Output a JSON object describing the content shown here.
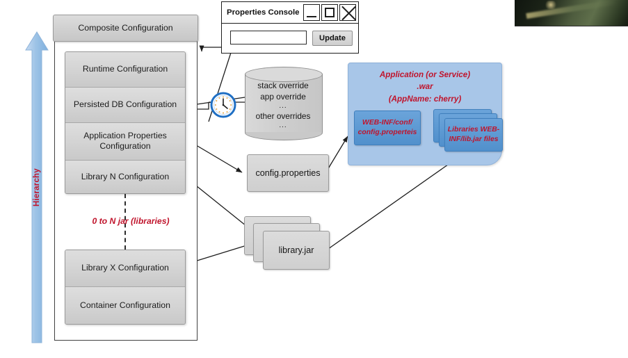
{
  "diagram": {
    "title": "Composite Configuration Hierarchy",
    "hierarchy_label": "Hierarchy",
    "composite_box": "Composite Configuration",
    "config_rows_top": [
      "Runtime Configuration",
      "Persisted DB Configuration",
      "Application Properties Configuration",
      "Library N Configuration"
    ],
    "config_rows_bottom": [
      "Library X Configuration",
      "Container Configuration"
    ],
    "jar_note": "0 to N jar (libraries)"
  },
  "properties_console": {
    "title": "Properties Console",
    "input_value": "",
    "input_placeholder": "",
    "update_label": "Update",
    "buttons": {
      "minimize": "minimize-button",
      "maximize": "maximize-button",
      "close": "close-button"
    }
  },
  "overrides_cylinder": {
    "line1": "stack override",
    "line2": "app override",
    "dots1": "...",
    "line3": "other overrides",
    "dots2": "..."
  },
  "files": {
    "config_properties": "config.properties",
    "library_jar": "library.jar"
  },
  "application": {
    "title_line1": "Application (or Service)",
    "title_line2": ".war",
    "title_line3": "(AppName: cherry)",
    "webinf_conf": "WEB-INF/conf/ config.properteis",
    "libraries": "Libraries WEB-INF/lib.jar files"
  },
  "icons": {
    "clock": "clock-icon",
    "hierarchy_arrow": "up-arrow-icon"
  },
  "colors": {
    "accent_red": "#c0142c",
    "app_blue": "#a8c6e8",
    "inner_blue": "#5b9bd5",
    "grey_box": "#d2d2d2",
    "arrow_blue": "#9dc3e6"
  }
}
